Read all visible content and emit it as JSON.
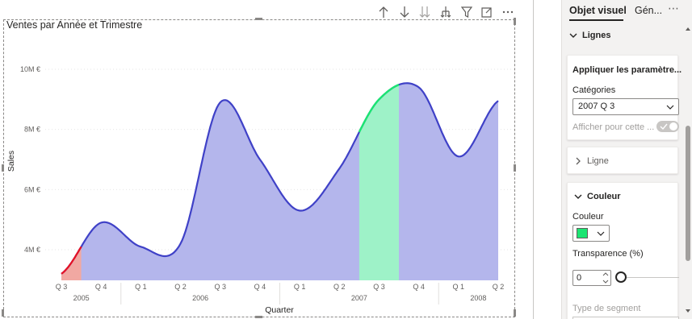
{
  "visual_toolbar": {
    "icons": [
      "arrow-up-icon",
      "arrow-down-icon",
      "double-arrow-down-icon",
      "expand-hierarchy-icon",
      "filter-icon",
      "focus-mode-icon",
      "more-options-icon"
    ]
  },
  "chart_data": {
    "type": "area",
    "title": "Ventes par Année et Trimestre",
    "xlabel": "Quarter",
    "ylabel": "Sales",
    "y_ticks": [
      "4M €",
      "6M €",
      "8M €",
      "10M €"
    ],
    "ylim": [
      3000000,
      11200000
    ],
    "grid": true,
    "categories": [
      "Q 3",
      "Q 4",
      "Q 1",
      "Q 2",
      "Q 3",
      "Q 4",
      "Q 1",
      "Q 2",
      "Q 3",
      "Q 4",
      "Q 1",
      "Q 2"
    ],
    "years": [
      {
        "label": "2005",
        "from": 0,
        "to": 1
      },
      {
        "label": "2006",
        "from": 2,
        "to": 5
      },
      {
        "label": "2007",
        "from": 6,
        "to": 9
      },
      {
        "label": "2008",
        "from": 10,
        "to": 11
      }
    ],
    "series": [
      {
        "values": [
          3200000,
          4900000,
          4100000,
          4200000,
          8900000,
          7000000,
          5300000,
          6700000,
          9000000,
          9400000,
          7100000,
          8950000
        ]
      }
    ],
    "colors": {
      "line": "#3f41c7",
      "fill": "#b4b6ec",
      "low_segment_line": "#e81123",
      "low_segment_fill": "#f1a8a2",
      "highlight_line": "#1be572",
      "highlight_fill": "#9ef2c8"
    },
    "highlighted_category_index": 8,
    "low_category_index": 0
  },
  "pane": {
    "tab_visual": "Objet visuel",
    "tab_general": "Gén...",
    "more": "⋯",
    "section_lignes": "Lignes",
    "apply_title": "Appliquer les paramètre...",
    "categories_label": "Catégories",
    "categories_value": "2007 Q 3",
    "show_for_label": "Afficher pour cette ...",
    "ligne_label": "Ligne",
    "couleur_header": "Couleur",
    "couleur_label": "Couleur",
    "couleur_value": "#1be572",
    "transparence_label": "Transparence (%)",
    "transparence_value": "0",
    "transparence_fraction": 0,
    "type_segment_label": "Type de segment"
  }
}
